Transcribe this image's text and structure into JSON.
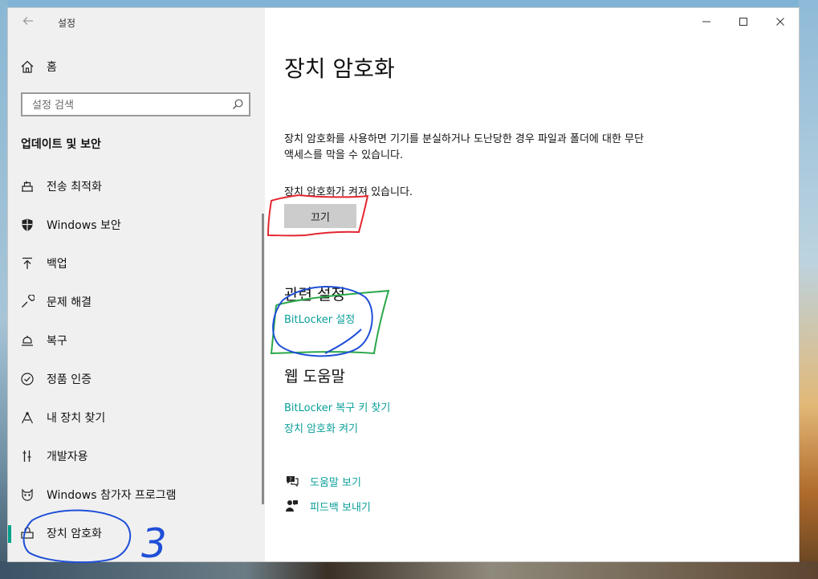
{
  "window": {
    "app_title": "설정",
    "controls": {
      "minimize": "—",
      "maximize": "☐",
      "close": "✕"
    }
  },
  "sidebar": {
    "home_label": "홈",
    "search_placeholder": "설정 검색",
    "section_title": "업데이트 및 보안",
    "items": [
      {
        "label": "전송 최적화",
        "icon": "delivery-optimization-icon"
      },
      {
        "label": "Windows 보안",
        "icon": "shield-icon"
      },
      {
        "label": "백업",
        "icon": "backup-arrow-icon"
      },
      {
        "label": "문제 해결",
        "icon": "wrench-icon"
      },
      {
        "label": "복구",
        "icon": "recovery-icon"
      },
      {
        "label": "정품 인증",
        "icon": "check-circle-icon"
      },
      {
        "label": "내 장치 찾기",
        "icon": "find-device-icon"
      },
      {
        "label": "개발자용",
        "icon": "developer-tools-icon"
      },
      {
        "label": "Windows 참가자 프로그램",
        "icon": "insider-cat-icon"
      },
      {
        "label": "장치 암호화",
        "icon": "device-encryption-icon",
        "active": true
      }
    ],
    "accent_color": "#00a18c"
  },
  "main": {
    "title": "장치 암호화",
    "description": "장치 암호화를 사용하면 기기를 분실하거나 도난당한 경우 파일과 폴더에 대한 무단 액세스를 막을 수 있습니다.",
    "status": "장치 암호화가 켜져 있습니다.",
    "off_button": "끄기",
    "related_heading": "관련 설정",
    "related_link": "BitLocker 설정",
    "web_help_heading": "웹 도움말",
    "web_help_links": [
      "BitLocker 복구 키 찾기",
      "장치 암호화 켜기"
    ],
    "help_link": "도움말 보기",
    "feedback_link": "피드백 보내기",
    "link_color": "#0a9f9a"
  },
  "annotations": {
    "number_label": "3",
    "colors": {
      "red": "#e3262f",
      "green": "#2aa84a",
      "blue": "#1f4fd8"
    }
  }
}
